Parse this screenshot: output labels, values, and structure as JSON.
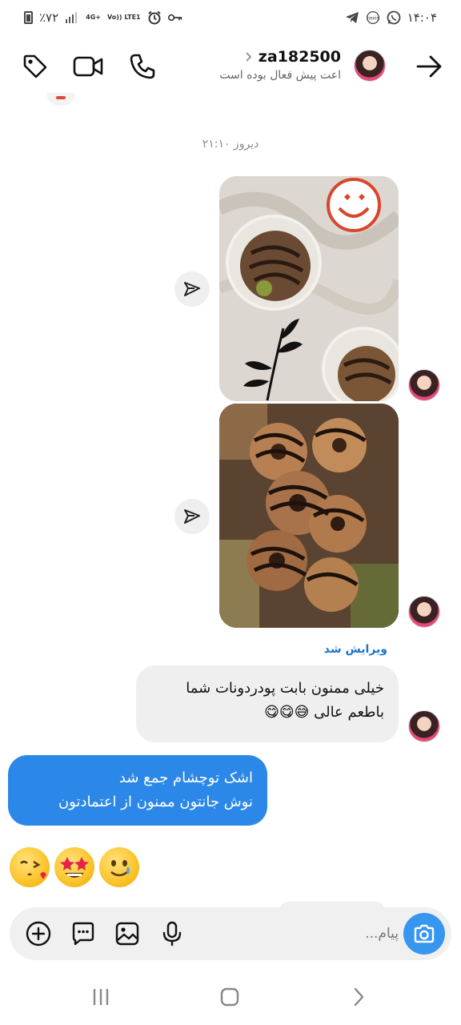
{
  "status_bar": {
    "battery": "٪۷۲",
    "network": "4G+",
    "volte": "Vo)) LTE1",
    "clock": "۱۴:۰۴",
    "icons": [
      "battery-icon",
      "signal-icon",
      "alarm-icon",
      "key-icon",
      "telegram-icon",
      "nexis-icon",
      "whatsapp-icon"
    ]
  },
  "header": {
    "username": "za182500",
    "activity": "اعت پیش فعال بوده است",
    "icons": [
      "tag-icon",
      "video-call-icon",
      "phone-icon",
      "chevron-right-icon",
      "back-arrow-icon"
    ]
  },
  "conversation": {
    "timestamp": "دیروز ۲۱:۱۰",
    "edited_label": "ویرایش شد",
    "received_message_line1": "خیلی ممنون بابت پودردونات شما",
    "received_message_line2": "باطعم عالی 😅😋😋",
    "sent_message_line1": "اشک توچشام جمع شد",
    "sent_message_line2": "نوش جانتون ممنون از اعتمادتون",
    "emojis": [
      "😘",
      "🤩",
      "🥲"
    ]
  },
  "composer": {
    "placeholder": "پیام...",
    "icons": [
      "add-icon",
      "sticker-icon",
      "gallery-icon",
      "microphone-icon",
      "camera-icon"
    ]
  },
  "colors": {
    "accent": "#3797f0",
    "sent_bubble": "#2c88e8",
    "received_bubble": "#efefef",
    "edited": "#1a73c9"
  }
}
